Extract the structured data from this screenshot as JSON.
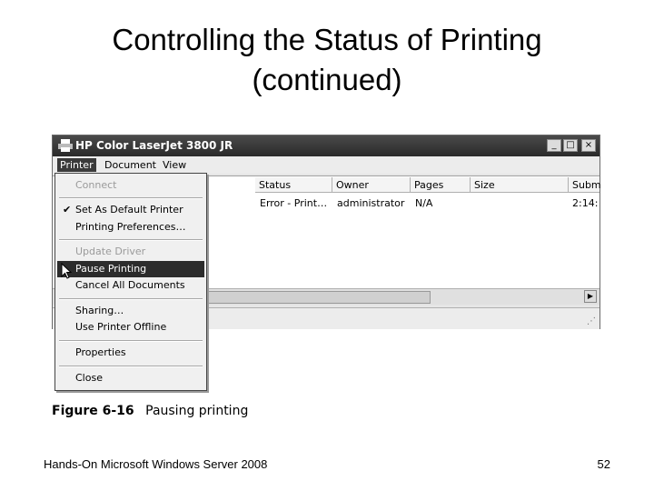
{
  "slide": {
    "title_line1": "Controlling the Status of Printing",
    "title_line2": "(continued)",
    "footer_left": "Hands-On Microsoft Windows Server 2008",
    "page_number": "52"
  },
  "window": {
    "title": "HP Color LaserJet 3800 JR",
    "controls": {
      "minimize": "_",
      "maximize": "□",
      "close": "×"
    },
    "menubar": [
      "Printer",
      "Document",
      "View"
    ],
    "columns": [
      "Status",
      "Owner",
      "Pages",
      "Size",
      "Subm"
    ],
    "row": {
      "status": "Error - Print…",
      "owner": "administrator",
      "pages": "N/A",
      "size": "",
      "submitted": "2:14:"
    }
  },
  "menu": {
    "items": [
      {
        "label": "Connect",
        "state": "disabled"
      },
      {
        "label": "Set As Default Printer",
        "state": "checked"
      },
      {
        "label": "Printing Preferences…",
        "state": "normal"
      },
      {
        "label": "Update Driver",
        "state": "disabled"
      },
      {
        "label": "Pause Printing",
        "state": "highlighted"
      },
      {
        "label": "Cancel All Documents",
        "state": "normal"
      },
      {
        "label": "Sharing…",
        "state": "normal"
      },
      {
        "label": "Use Printer Offline",
        "state": "normal"
      },
      {
        "label": "Properties",
        "state": "normal"
      },
      {
        "label": "Close",
        "state": "normal"
      }
    ],
    "check_glyph": "✔"
  },
  "caption": {
    "figure": "Figure 6-16",
    "text": "Pausing printing"
  },
  "colors": {
    "titlebar": "#2a2a2a",
    "highlight": "#2c2c2c"
  }
}
